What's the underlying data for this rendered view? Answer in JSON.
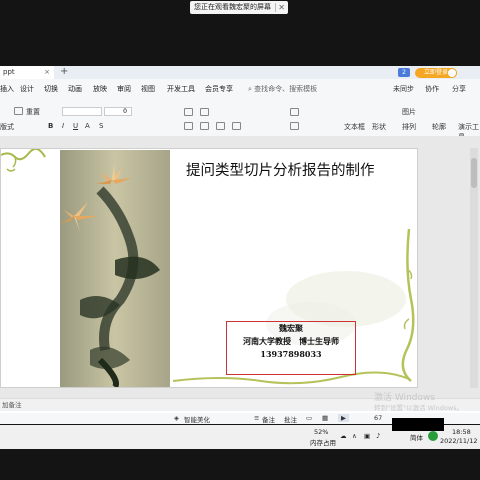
{
  "share_banner": {
    "text": "您正在观看魏宏聚的屏幕",
    "close_icon": "close-icon"
  },
  "app": {
    "tab_title": "ppt",
    "tab_prefix": "…",
    "login_label": "立即登录",
    "notif_count": "2"
  },
  "menu": {
    "items": [
      "插入",
      "设计",
      "切换",
      "动画",
      "放映",
      "审阅",
      "视图",
      "开发工具",
      "会员专享"
    ],
    "search_placeholder": "查找命令、搜索模板",
    "right_items": [
      "未同步",
      "协作",
      "分享"
    ]
  },
  "toolbar": {
    "groups": [
      "版式",
      "重置",
      "文本框",
      "形状",
      "排列",
      "演示工具"
    ],
    "font_size": "0",
    "picture_label": "图片",
    "outline_label": "轮廓"
  },
  "slide": {
    "title": "提问类型切片分析报告的制作",
    "author_name": "魏宏聚",
    "author_title": "河南大学教授　博士生导师",
    "phone": "13937898033"
  },
  "notes": {
    "placeholder": "加备注"
  },
  "statusbar": {
    "beautify": "智能美化",
    "notes_label": "备注",
    "comment_label": "批注",
    "zoom": "67"
  },
  "watermark": {
    "line1": "激活 Windows",
    "line2": "转到\"设置\"以激活 Windows。"
  },
  "taskbar": {
    "mem_percent": "52%",
    "mem_label": "内存占用",
    "ime": "简体",
    "time": "18:58",
    "date": "2022/11/12"
  },
  "colors": {
    "accent": "#f5a623",
    "border_red": "#cc3333",
    "vine": "#a8b84a"
  }
}
